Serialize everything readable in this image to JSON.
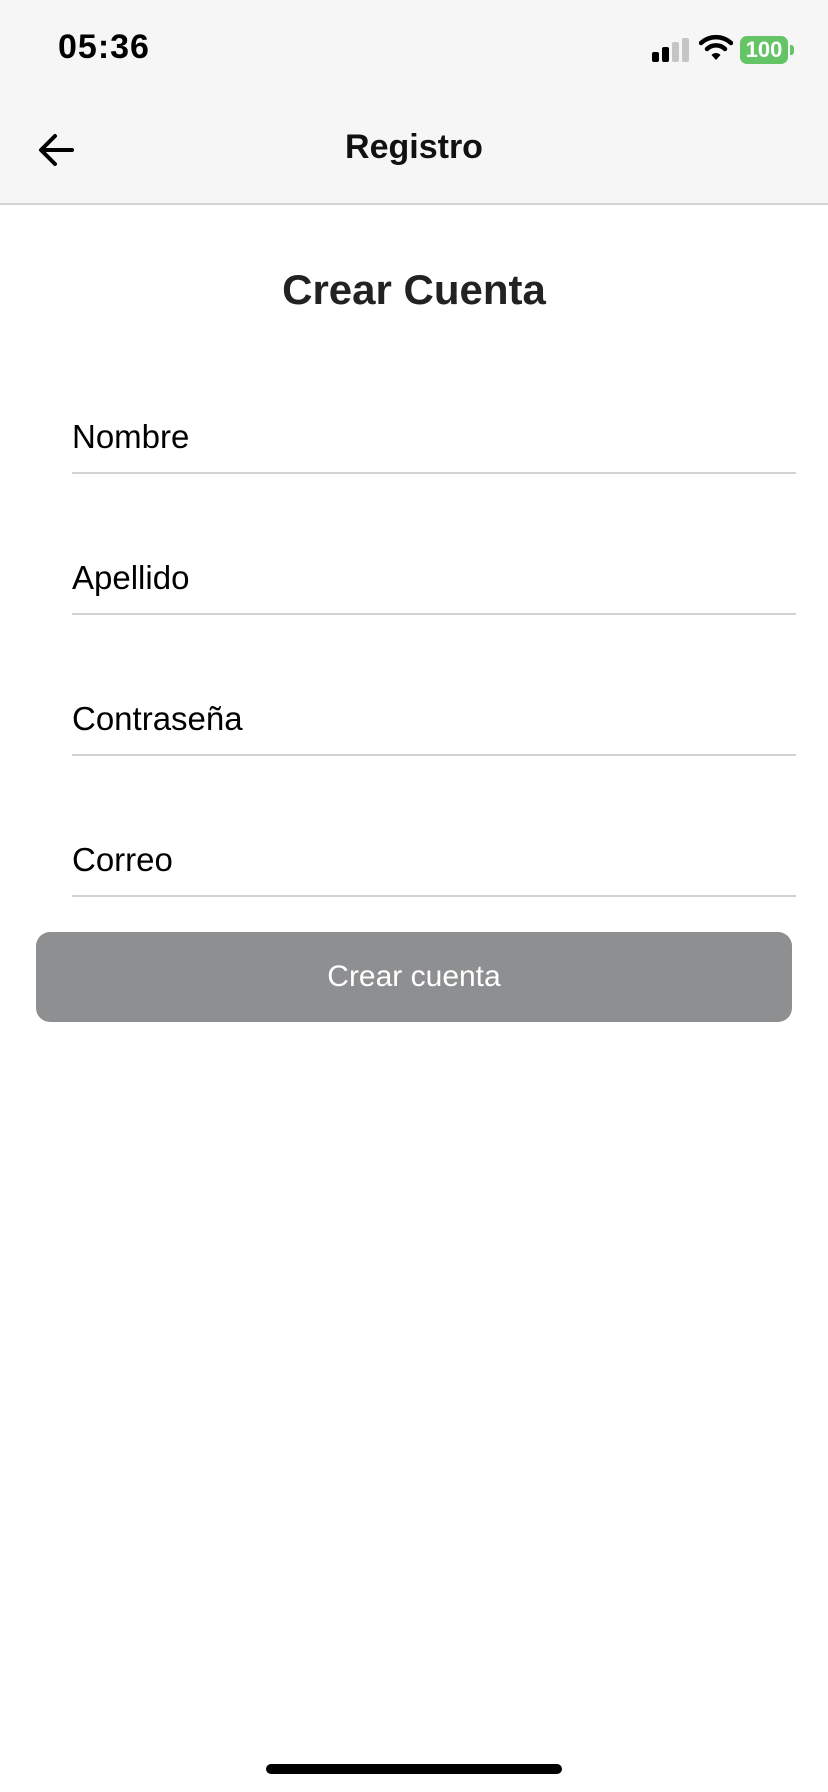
{
  "status_bar": {
    "time": "05:36",
    "battery_level": "100",
    "battery_color": "#65c466",
    "signal_bars_active": 2,
    "signal_bars_total": 4
  },
  "nav": {
    "back_icon": "arrow-left-icon",
    "title": "Registro"
  },
  "form": {
    "title": "Crear Cuenta",
    "fields": {
      "nombre_placeholder": "Nombre",
      "apellido_placeholder": "Apellido",
      "contrasena_placeholder": "Contraseña",
      "correo_placeholder": "Correo"
    },
    "submit_label": "Crear cuenta",
    "submit_color": "#8e8f91"
  }
}
